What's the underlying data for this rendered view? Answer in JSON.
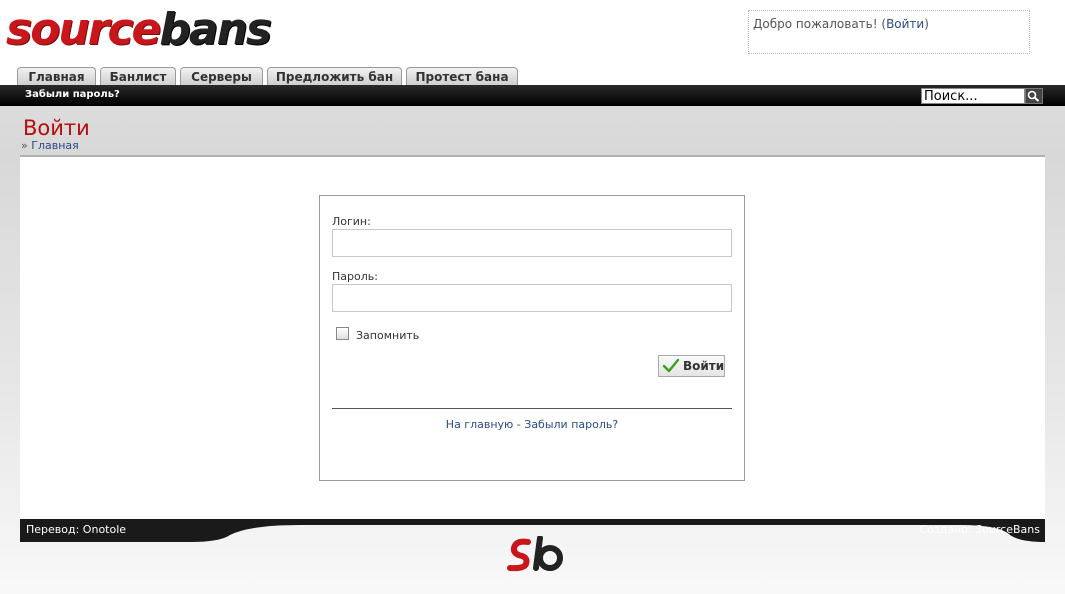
{
  "logo": {
    "part1": "source",
    "part2": "bans"
  },
  "welcome": {
    "text": "Добро пожаловать! (",
    "login_link": "Войти",
    "close": ")"
  },
  "tabs": [
    "Главная",
    "Банлист",
    "Серверы",
    "Предложить бан",
    "Протест бана"
  ],
  "navbar": {
    "forgot_password": "Забыли пароль?",
    "search_value": "Поиск..."
  },
  "page": {
    "title": "Войти",
    "breadcrumb_sep": "»",
    "breadcrumb": "Главная"
  },
  "login": {
    "username_label": "Логин:",
    "password_label": "Пароль:",
    "remember_label": "Запомнить",
    "submit_label": "Войти",
    "bottom_links": "На главную - Забыли пароль?"
  },
  "footer": {
    "left": "Перевод: Onotole",
    "right": "Создано: SourceBans"
  },
  "colors": {
    "brand_red": "#c8161b",
    "title_red": "#b50c0c",
    "link_blue": "#2a4a8a"
  },
  "icons": {
    "search": "search-icon",
    "submit": "checkmark-icon",
    "footer_logo": "sb-logo"
  }
}
